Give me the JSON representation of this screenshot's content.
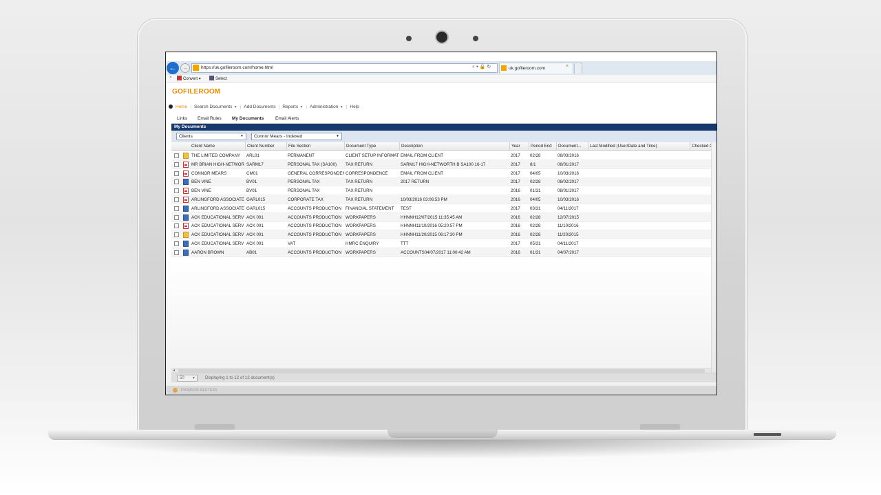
{
  "browser": {
    "url": "https://uk.gofileroom.com/home.html",
    "tab_title": "uk.gofileroom.com",
    "address_icons": "⌕ ▾ 🔒 ↻",
    "tab_close": "×",
    "cmd_close": "×",
    "convert_label": "Convert",
    "select_label": "Select",
    "dropdown_caret": "▾"
  },
  "app": {
    "logo": "GOFILEROOM",
    "nav": [
      {
        "label": "Home",
        "active": true
      },
      {
        "label": "Search Documents",
        "dropdown": true
      },
      {
        "label": "Add Documents"
      },
      {
        "label": "Reports",
        "dropdown": true
      },
      {
        "label": "Administration",
        "dropdown": true
      },
      {
        "label": "Help"
      }
    ],
    "subtabs": [
      "Links",
      "Email Rules",
      "My Documents",
      "Email Alerts"
    ],
    "active_subtab": "My Documents",
    "panel_title": "My Documents",
    "filter1": "Clients",
    "filter2": "Connor Mears - Indexed",
    "columns": [
      "Client Name",
      "Client Number",
      "File Section",
      "Document Type",
      "Description",
      "Year",
      "Period End",
      "Document...",
      "Last Modified (User/Date and Time)",
      "Checked Out"
    ],
    "rows": [
      {
        "icon": "msg",
        "client": "THE LIMITED COMPANY",
        "number": "ARL01",
        "section": "PERMANENT",
        "doctype": "CLIENT SETUP INFORMAT",
        "desc": "EMAIL FROM CLIENT",
        "year": "2017",
        "period": "02/28",
        "docdate": "08/03/2016"
      },
      {
        "icon": "pdf",
        "client": "MR BRIAN HIGH-NETWOR",
        "number": "SARM17",
        "section": "PERSONAL TAX (SA100)",
        "doctype": "TAX RETURN",
        "desc": "SARM17 HIGH-NETWORTH B SA100 16-17",
        "year": "2017",
        "period": "8/1",
        "docdate": "08/01/2017"
      },
      {
        "icon": "pdf",
        "client": "CONNOR MEARS",
        "number": "CM01",
        "section": "GENERAL CORRESPONDEN",
        "doctype": "CORRESPONDENCE",
        "desc": "EMAIL FROM CLIENT",
        "year": "2017",
        "period": "04/05",
        "docdate": "10/03/2016"
      },
      {
        "icon": "doc",
        "client": "BEN VINE",
        "number": "BV01",
        "section": "PERSONAL TAX",
        "doctype": "TAX RETURN",
        "desc": "2017 RETURN",
        "year": "2017",
        "period": "02/28",
        "docdate": "08/02/2017"
      },
      {
        "icon": "pdf",
        "client": "BEN VINE",
        "number": "BV01",
        "section": "PERSONAL TAX",
        "doctype": "TAX RETURN",
        "desc": "",
        "year": "2016",
        "period": "01/31",
        "docdate": "08/01/2017"
      },
      {
        "icon": "pdf",
        "client": "ARLINGFORD ASSOCIATE",
        "number": "GARL015",
        "section": "CORPORATE TAX",
        "doctype": "TAX RETURN",
        "desc": "10/03/2016 03:06:53 PM",
        "year": "2016",
        "period": "04/05",
        "docdate": "10/03/2016"
      },
      {
        "icon": "doc",
        "client": "ARLINGFORD ASSOCIATE",
        "number": "GARL015",
        "section": "ACCOUNTS PRODUCTION",
        "doctype": "FINANCIAL STATEMENT",
        "desc": "TEST",
        "year": "2017",
        "period": "03/31",
        "docdate": "04/11/2017"
      },
      {
        "icon": "doc",
        "client": "ACK EDUCATIONAL SERV",
        "number": "ACK 001",
        "section": "ACCOUNTS PRODUCTION",
        "doctype": "WORKPAPERS",
        "desc": "HHNNH12/07/2015 11:35:45 AM",
        "year": "2016",
        "period": "02/28",
        "docdate": "12/07/2015"
      },
      {
        "icon": "pdf",
        "client": "ACK EDUCATIONAL SERV",
        "number": "ACK 001",
        "section": "ACCOUNTS PRODUCTION",
        "doctype": "WORKPAPERS",
        "desc": "HHNNH11/10/2016 05:20:57 PM",
        "year": "2016",
        "period": "02/28",
        "docdate": "11/10/2016"
      },
      {
        "icon": "msg",
        "client": "ACK EDUCATIONAL SERV",
        "number": "ACK 001",
        "section": "ACCOUNTS PRODUCTION",
        "doctype": "WORKPAPERS",
        "desc": "HHNNH11/20/2015 06:17:30 PM",
        "year": "2016",
        "period": "02/28",
        "docdate": "11/20/2015"
      },
      {
        "icon": "doc",
        "client": "ACK EDUCATIONAL SERV",
        "number": "ACK 001",
        "section": "VAT",
        "doctype": "HMRC ENQUIRY",
        "desc": "TTT",
        "year": "2017",
        "period": "05/31",
        "docdate": "04/11/2017"
      },
      {
        "icon": "doc",
        "client": "AARON BROWN",
        "number": "AB01",
        "section": "ACCOUNTS PRODUCTION",
        "doctype": "WORKPAPERS",
        "desc": "ACCOUNTS04/07/2017 11:00:42 AM",
        "year": "2016",
        "period": "01/31",
        "docdate": "04/07/2017"
      }
    ],
    "page_size": "50",
    "pager_text": "Displaying 1 to 12 of 12 document(s)",
    "footer": "THOMSON REUTERS",
    "scroll_left_arrow": "◂"
  }
}
